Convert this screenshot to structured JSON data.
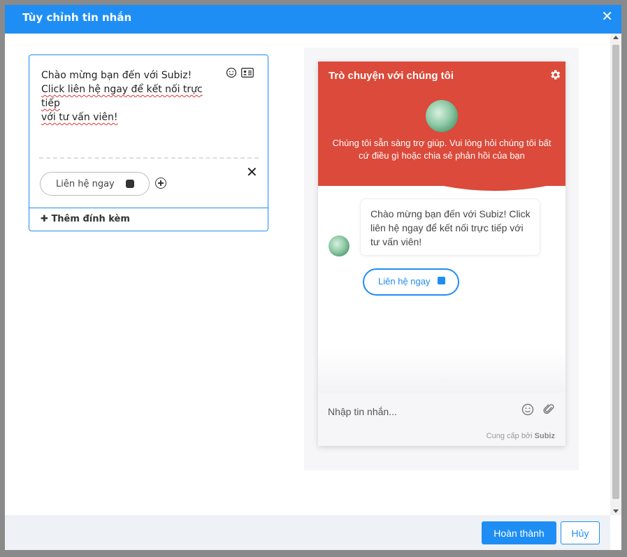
{
  "modal": {
    "title": "Tùy chỉnh tin nhắn",
    "close_icon": "close-icon"
  },
  "editor": {
    "lines": [
      "Chào mừng bạn đến với Subiz!",
      "Click liên hệ ngay để kết nối trực tiếp",
      "với tư vấn viên!"
    ],
    "button_label": "Liên hệ ngay",
    "attach_label": "Thêm đính kèm",
    "icons": [
      "emoji-icon",
      "contact-card-icon",
      "close-icon",
      "phone-icon",
      "add-circle-icon",
      "plus-icon"
    ]
  },
  "preview": {
    "header_title": "Trò chuyện với chúng tôi",
    "header_desc": "Chúng tôi sẵn sàng trợ giúp. Vui lòng hỏi chúng tôi bất cứ điều gì hoặc chia sẻ phản hồi của bạn",
    "message_text": "Chào mừng bạn đến với Subiz! Click liên hệ ngay để kết nối trực tiếp với tư vấn viên!",
    "action_label": "Liên hệ ngay",
    "input_placeholder": "Nhập tin nhắn...",
    "powered_prefix": "Cung cấp bởi",
    "powered_brand": "Subiz",
    "header_color": "#db4a3a"
  },
  "footer": {
    "confirm_label": "Hoàn thành",
    "cancel_label": "Hủy"
  },
  "colors": {
    "accent": "#1e8ef5",
    "widget_header": "#db4a3a"
  }
}
